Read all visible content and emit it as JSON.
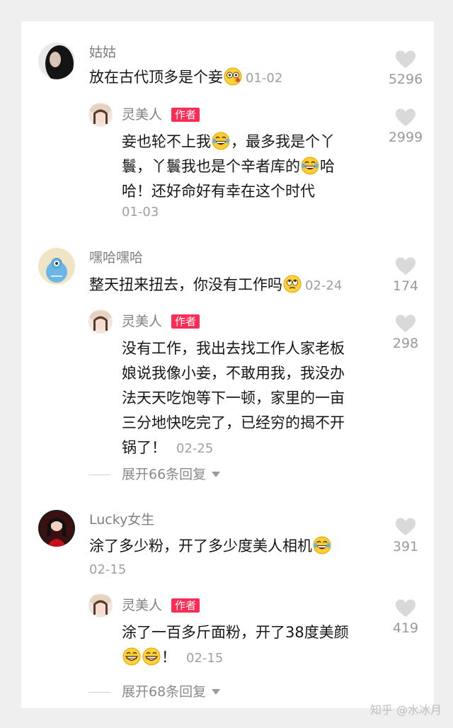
{
  "comments": [
    {
      "user": "姑姑",
      "text_line1": "放在古代顶多是个妾",
      "emoji1": "face-with-monocle-emoji",
      "date": "01-02",
      "likes": "5296",
      "reply": {
        "user": "灵美人",
        "badge": "作者",
        "line1_a": "妾也轮不上我",
        "line1_b": "，最多我是个丫",
        "line2_a": "鬟，丫鬟我也是个辛者库的",
        "line2_b": "哈",
        "line3": "哈！还好命好有幸在这个时代",
        "date": "01-03",
        "likes": "2999"
      }
    },
    {
      "user": "嘿哈嘿哈",
      "text_line1": "整天扭来扭去，你没有工作吗",
      "date": "02-24",
      "likes": "174",
      "reply": {
        "user": "灵美人",
        "badge": "作者",
        "line1": "没有工作，我出去找工作人家老板",
        "line2": "娘说我像小妾，不敢用我，我没办",
        "line3": "法天天吃饱等下一顿，家里的一亩",
        "line4": "三分地快吃完了，已经穷的揭不开",
        "line5": "锅了！",
        "date": "02-25",
        "likes": "298"
      },
      "expand": "展开66条回复"
    },
    {
      "user": "Lucky女生",
      "text_line1": "涂了多少粉，开了多少度美人相机",
      "date": "02-15",
      "likes": "391",
      "reply": {
        "user": "灵美人",
        "badge": "作者",
        "line1": "涂了一百多斤面粉，开了38度美颜",
        "line2": "！",
        "date": "02-15",
        "likes": "419"
      },
      "expand": "展开68条回复"
    }
  ],
  "watermark": "知乎 @水冰月",
  "colors": {
    "badge": "#fe2c55",
    "username": "#7f7f7f",
    "date": "#a0a0a0",
    "heart": "#d9d9d9",
    "card": "#ffffff",
    "page": "#efefef"
  },
  "icons": {
    "like": "heart-icon",
    "expand": "caret-down-icon"
  }
}
